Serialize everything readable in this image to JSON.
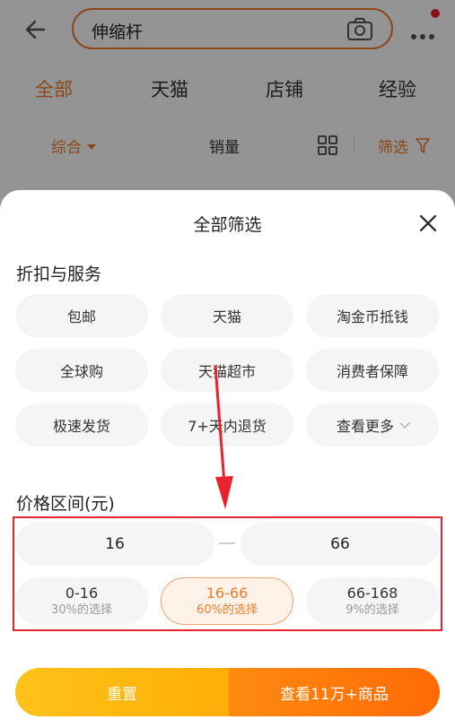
{
  "search": {
    "query": "伸缩杆"
  },
  "tabs": [
    "全部",
    "天猫",
    "店铺",
    "经验"
  ],
  "sort": {
    "comprehensive": "综合",
    "sales": "销量",
    "filter": "筛选"
  },
  "sheet": {
    "title": "全部筛选",
    "services_title": "折扣与服务",
    "services": [
      "包邮",
      "天猫",
      "淘金币抵钱",
      "全球购",
      "天猫超市",
      "消费者保障",
      "极速发货",
      "7+天内退货",
      "查看更多"
    ],
    "price_title": "价格区间(元)",
    "price_min": "16",
    "price_max": "66",
    "ranges": [
      {
        "range": "0-16",
        "percent": "30%的选择"
      },
      {
        "range": "16-66",
        "percent": "60%的选择"
      },
      {
        "range": "66-168",
        "percent": "9%的选择"
      }
    ],
    "reset_label": "重置",
    "confirm_label": "查看11万+商品"
  },
  "colors": {
    "accent": "#f07b2b",
    "highlight_box": "#e8232d",
    "annotation_arrow": "#e8232d"
  }
}
